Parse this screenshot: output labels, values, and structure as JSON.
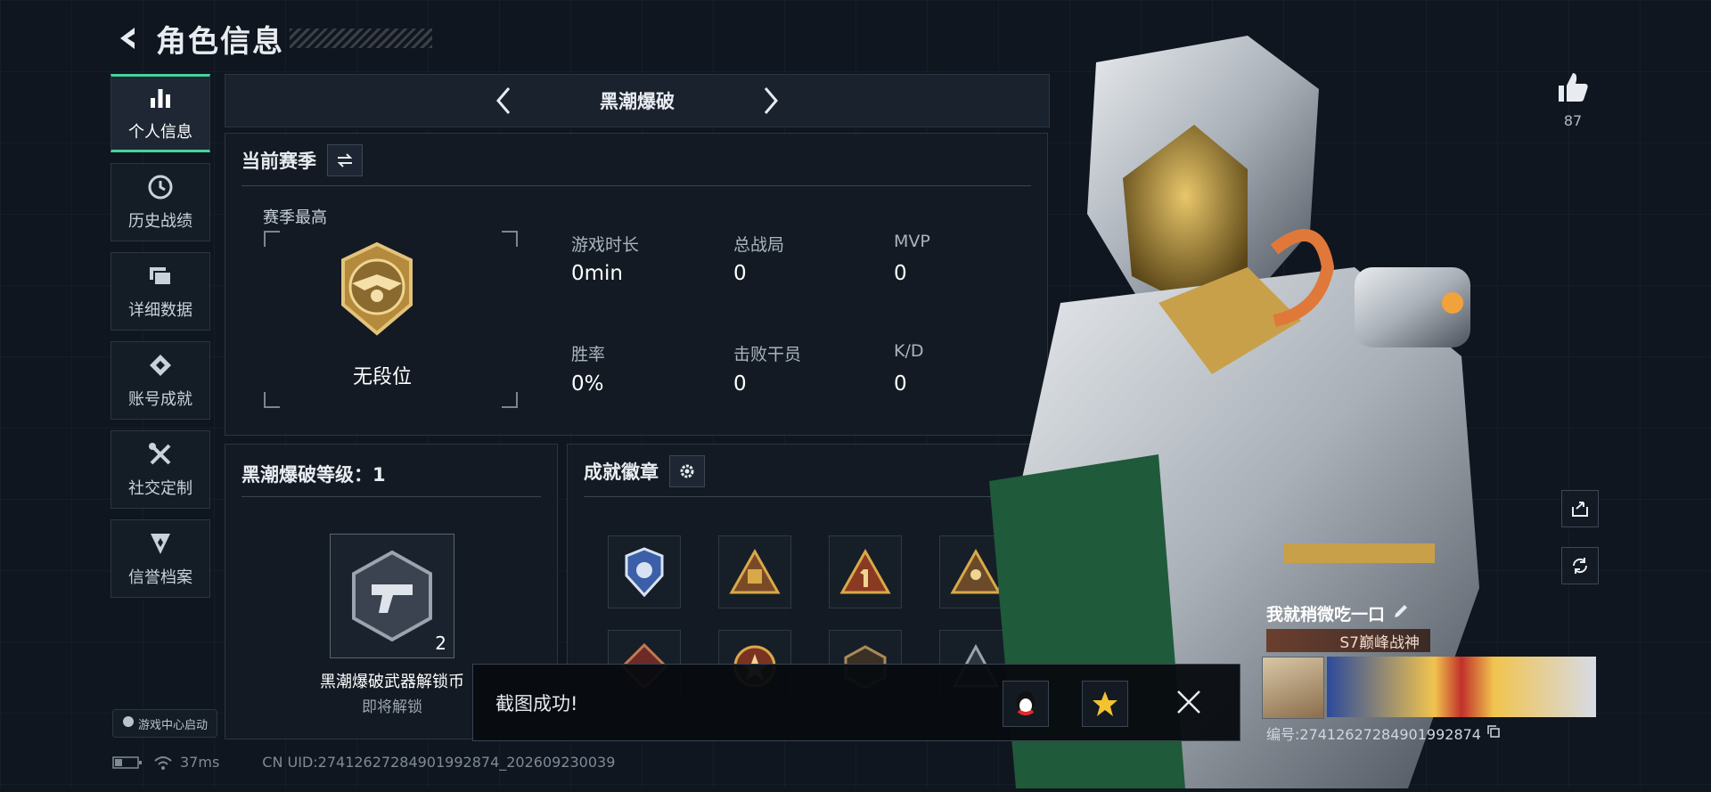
{
  "header": {
    "title": "角色信息"
  },
  "nav": {
    "items": [
      {
        "label": "个人信息",
        "icon": "bar-chart-icon"
      },
      {
        "label": "历史战绩",
        "icon": "clock-icon"
      },
      {
        "label": "详细数据",
        "icon": "folder-icon"
      },
      {
        "label": "账号成就",
        "icon": "diamond-icon"
      },
      {
        "label": "社交定制",
        "icon": "tools-icon"
      },
      {
        "label": "信誉档案",
        "icon": "shield-icon"
      }
    ],
    "launch_label": "游戏中心启动"
  },
  "mode": {
    "name": "黑潮爆破"
  },
  "season": {
    "title": "当前赛季",
    "best_label": "赛季最高",
    "rank_text": "无段位",
    "stats": [
      {
        "label": "游戏时长",
        "value": "0min"
      },
      {
        "label": "总战局",
        "value": "0"
      },
      {
        "label": "MVP",
        "value": "0"
      },
      {
        "label": "胜率",
        "value": "0%"
      },
      {
        "label": "击败干员",
        "value": "0"
      },
      {
        "label": "K/D",
        "value": "0"
      }
    ]
  },
  "level": {
    "title": "黑潮爆破等级：1",
    "reward_name": "黑潮爆破武器解锁币",
    "reward_count": "2",
    "reward_status": "即将解锁"
  },
  "badges": {
    "title": "成就徽章"
  },
  "toast": {
    "text": "截图成功!"
  },
  "status": {
    "ping": "37ms",
    "uid": "CN UID:27412627284901992874_202609230039"
  },
  "profile": {
    "likes": "87",
    "name": "我就稍微吃一口",
    "rank_tag": "S7巅峰战神",
    "id_line": "编号:27412627284901992874"
  },
  "colors": {
    "accent": "#47d39a",
    "gold": "#c9a04a"
  }
}
